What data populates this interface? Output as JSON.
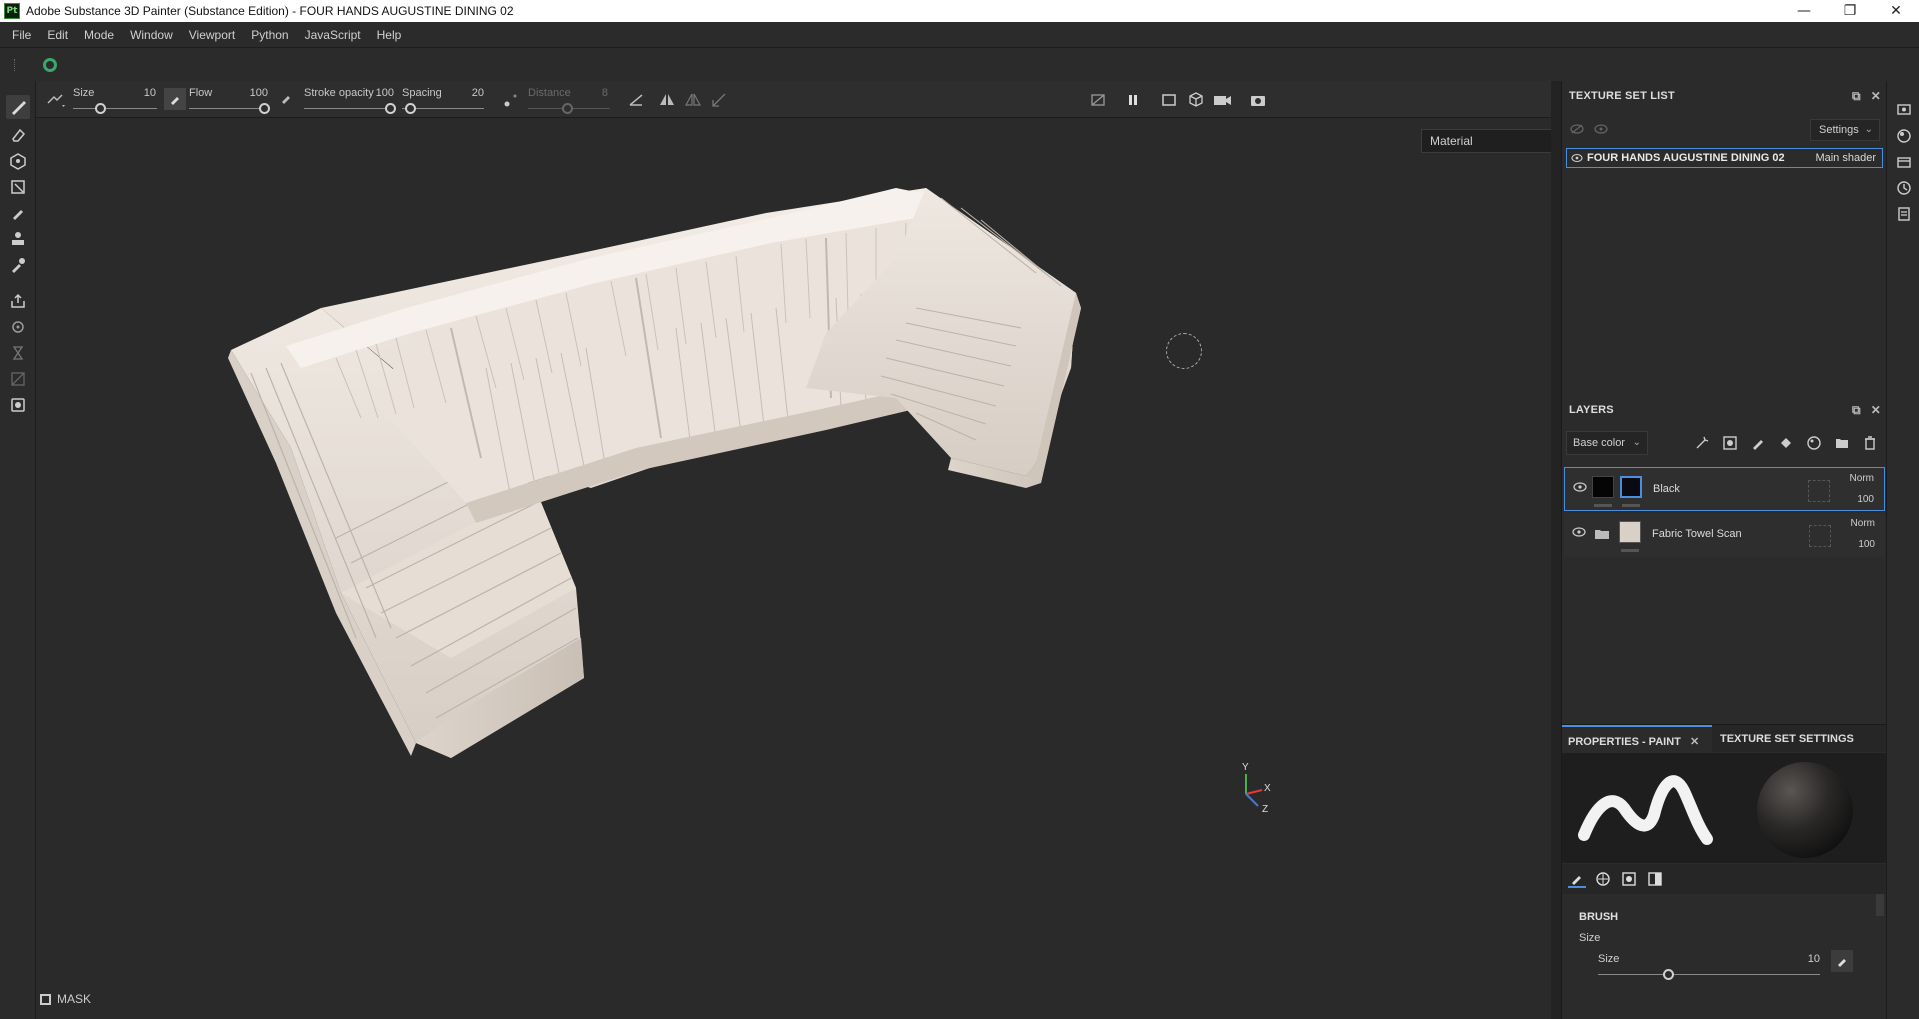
{
  "window": {
    "app_icon": "Pt",
    "title": "Adobe Substance 3D Painter (Substance Edition) - FOUR HANDS AUGUSTINE DINING 02",
    "minimize": "—",
    "maximize": "❐",
    "close": "✕"
  },
  "menu": [
    "File",
    "Edit",
    "Mode",
    "Window",
    "Viewport",
    "Python",
    "JavaScript",
    "Help"
  ],
  "brush_toolbar": {
    "size_label": "Size",
    "size_value": "10",
    "flow_label": "Flow",
    "flow_value": "100",
    "stroke_opacity_label": "Stroke opacity",
    "stroke_opacity_value": "100",
    "spacing_label": "Spacing",
    "spacing_value": "20",
    "distance_label": "Distance",
    "distance_value": "8"
  },
  "viewport": {
    "material_select": "Material",
    "mask_label": "MASK",
    "axis_x": "X",
    "axis_y": "Y",
    "axis_z": "Z",
    "background_color": "#2a2a2a",
    "model_color": "#e8e0d8"
  },
  "texture_set_list": {
    "title": "TEXTURE SET LIST",
    "settings": "Settings",
    "item_name": "FOUR HANDS AUGUSTINE DINING 02",
    "item_shader": "Main shader"
  },
  "layers": {
    "title": "LAYERS",
    "channel": "Base color",
    "items": [
      {
        "name": "Black",
        "blend": "Norm",
        "opacity": "100",
        "selected": true
      },
      {
        "name": "Fabric Towel Scan",
        "blend": "Norm",
        "opacity": "100",
        "selected": false
      }
    ]
  },
  "properties": {
    "tab_paint": "PROPERTIES - PAINT",
    "tab_texture_set": "TEXTURE SET SETTINGS",
    "brush_title": "BRUSH",
    "brush_sub": "Size",
    "size_label": "Size",
    "size_value": "10"
  },
  "colors": {
    "accent": "#4a8ee0",
    "panel": "#2b2b2b",
    "viewport": "#2a2a2a"
  }
}
